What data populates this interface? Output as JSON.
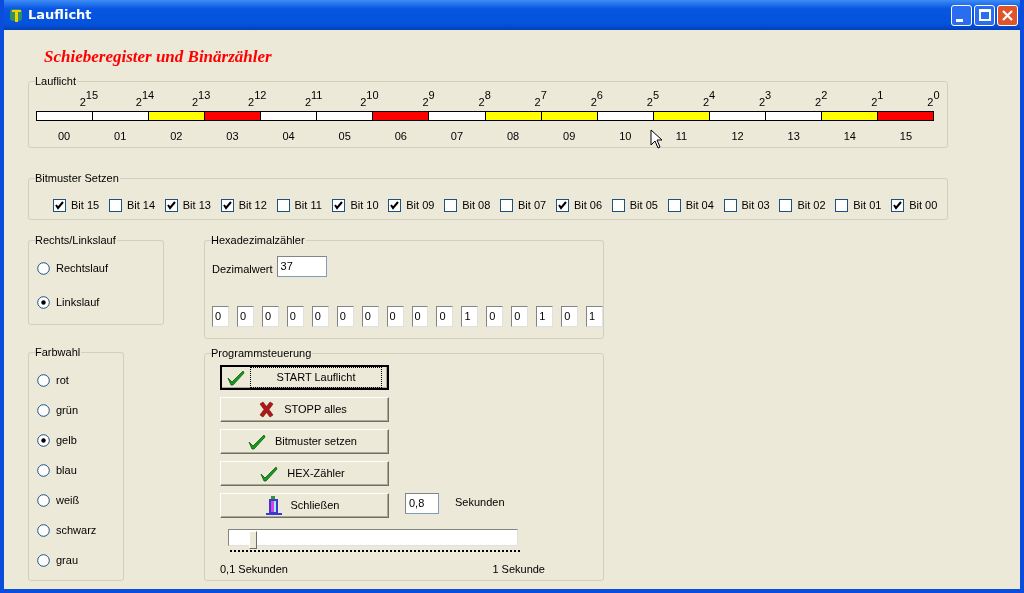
{
  "window": {
    "title": "Lauflicht",
    "controls": [
      {
        "kind": "minimize"
      },
      {
        "kind": "maximize"
      },
      {
        "kind": "close"
      }
    ]
  },
  "heading": "Schieberegister und Binärzähler",
  "lauflicht": {
    "label": "Lauflicht",
    "lamps": [
      {
        "power": "2$^{15}$",
        "label": "00",
        "color": "#ffffff"
      },
      {
        "power": "2$^{14}$",
        "label": "01",
        "color": "#ffffff"
      },
      {
        "power": "2$^{13}$",
        "label": "02",
        "color": "#ffff00"
      },
      {
        "power": "2$^{12}$",
        "label": "03",
        "color": "#ff0000"
      },
      {
        "power": "2$^{11}$",
        "label": "04",
        "color": "#ffffff"
      },
      {
        "power": "2$^{10}$",
        "label": "05",
        "color": "#ffffff"
      },
      {
        "power": "2$^{9}$",
        "label": "06",
        "color": "#ff0000"
      },
      {
        "power": "2$^{8}$",
        "label": "07",
        "color": "#ffffff"
      },
      {
        "power": "2$^{7}$",
        "label": "08",
        "color": "#ffff00"
      },
      {
        "power": "2$^{6}$",
        "label": "09",
        "color": "#ffff00"
      },
      {
        "power": "2$^{5}$",
        "label": "10",
        "color": "#ffffff"
      },
      {
        "power": "2$^{4}$",
        "label": "11",
        "color": "#ffff00"
      },
      {
        "power": "2$^{3}$",
        "label": "12",
        "color": "#ffffff"
      },
      {
        "power": "2$^{2}$",
        "label": "13",
        "color": "#ffffff"
      },
      {
        "power": "2$^{1}$",
        "label": "14",
        "color": "#ffff00"
      },
      {
        "power": "2$^{0}$",
        "label": "15",
        "color": "#ff0000"
      }
    ]
  },
  "bitmuster": {
    "label": "Bitmuster Setzen",
    "bits": [
      {
        "label": "Bit 15",
        "checked": true
      },
      {
        "label": "Bit 14",
        "checked": false
      },
      {
        "label": "Bit 13",
        "checked": true
      },
      {
        "label": "Bit 12",
        "checked": true
      },
      {
        "label": "Bit 11",
        "checked": false
      },
      {
        "label": "Bit 10",
        "checked": true
      },
      {
        "label": "Bit 09",
        "checked": true
      },
      {
        "label": "Bit 08",
        "checked": false
      },
      {
        "label": "Bit 07",
        "checked": false
      },
      {
        "label": "Bit 06",
        "checked": true
      },
      {
        "label": "Bit 05",
        "checked": false
      },
      {
        "label": "Bit 04",
        "checked": false
      },
      {
        "label": "Bit 03",
        "checked": false
      },
      {
        "label": "Bit 02",
        "checked": false
      },
      {
        "label": "Bit 01",
        "checked": false
      },
      {
        "label": "Bit 00",
        "checked": true
      }
    ]
  },
  "direction": {
    "label": "Rechts/Linkslauf",
    "options": [
      {
        "label": "Rechtslauf",
        "selected": false
      },
      {
        "label": "Linkslauf",
        "selected": true
      }
    ]
  },
  "color_choice": {
    "label": "Farbwahl",
    "options": [
      {
        "label": "rot",
        "selected": false
      },
      {
        "label": "grün",
        "selected": false
      },
      {
        "label": "gelb",
        "selected": true
      },
      {
        "label": "blau",
        "selected": false
      },
      {
        "label": "weiß",
        "selected": false
      },
      {
        "label": "schwarz",
        "selected": false
      },
      {
        "label": "grau",
        "selected": false
      }
    ]
  },
  "hex_counter": {
    "label": "Hexadezimalzähler",
    "decimal_label": "Dezimalwert",
    "decimal_value": "37",
    "digits": [
      "0",
      "0",
      "0",
      "0",
      "0",
      "0",
      "0",
      "0",
      "0",
      "0",
      "1",
      "0",
      "0",
      "1",
      "0",
      "1"
    ]
  },
  "program": {
    "label": "Programmsteuerung",
    "buttons": [
      {
        "label": "START Lauflicht",
        "kind": "check",
        "focused": true
      },
      {
        "label": "STOPP alles",
        "kind": "cross",
        "focused": false
      },
      {
        "label": "Bitmuster setzen",
        "kind": "check",
        "focused": false
      },
      {
        "label": "HEX-Zähler",
        "kind": "check",
        "focused": false
      },
      {
        "label": "Schließen",
        "kind": "exit",
        "focused": false
      }
    ],
    "interval_value": "0,8",
    "interval_unit": "Sekunden",
    "slider": {
      "level": 0.07
    },
    "slider_min_label": "0,1 Sekunden",
    "slider_max_label": "1 Sekunde"
  }
}
